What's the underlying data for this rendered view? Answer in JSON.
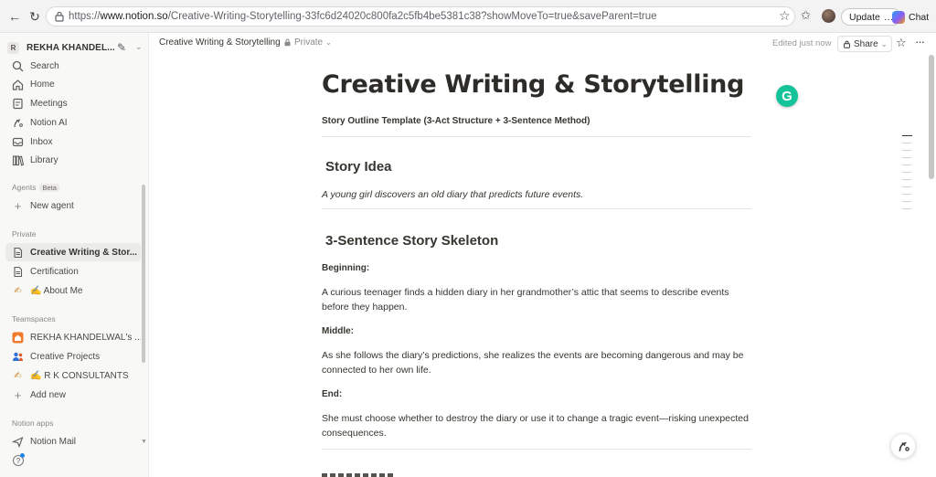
{
  "browser": {
    "url_scheme": "https://",
    "url_host": "www.notion.so",
    "url_path": "/Creative-Writing-Storytelling-33fc6d24020c800fa2c5fb4be5381c38?showMoveTo=true&saveParent=true",
    "update_label": "Update",
    "update_more": "…",
    "chat_label": "Chat"
  },
  "sidebar": {
    "workspace_badge": "R",
    "workspace_name": "REKHA KHANDEL...",
    "top_items": [
      {
        "label": "Search",
        "icon": "search-icon"
      },
      {
        "label": "Home",
        "icon": "home-icon"
      },
      {
        "label": "Meetings",
        "icon": "meetings-icon"
      },
      {
        "label": "Notion AI",
        "icon": "notion-ai-icon"
      },
      {
        "label": "Inbox",
        "icon": "inbox-icon"
      },
      {
        "label": "Library",
        "icon": "library-icon"
      }
    ],
    "agents_label": "Agents",
    "beta_label": "Beta",
    "new_agent": "New agent",
    "private_label": "Private",
    "private_items": [
      {
        "label": "Creative Writing & Stor...",
        "icon": "page-icon",
        "active": true
      },
      {
        "label": "Certification",
        "icon": "page-icon"
      },
      {
        "label": "✍️ About Me",
        "icon": "writing-hand-icon"
      }
    ],
    "teamspaces_label": "Teamspaces",
    "teamspace_items": [
      {
        "label": "REKHA KHANDELWAL's ...",
        "icon": "home-orange-icon"
      },
      {
        "label": "Creative Projects",
        "icon": "people-icon"
      },
      {
        "label": "✍️ R K CONSULTANTS",
        "icon": "writing-hand-icon"
      },
      {
        "label": "Add new",
        "icon": "plus-icon"
      }
    ],
    "notion_apps_label": "Notion apps",
    "notion_mail": "Notion Mail"
  },
  "topbar": {
    "breadcrumb": "Creative Writing & Storytelling",
    "privacy": "Private",
    "edited": "Edited just now",
    "share": "Share"
  },
  "page": {
    "title": "Creative Writing & Storytelling",
    "subtitle": "Story Outline Template (3-Act Structure + 3-Sentence Method)",
    "story_idea_heading": "Story Idea",
    "story_idea_text": "A young girl discovers an old diary that predicts future events.",
    "skeleton_heading": "3-Sentence Story Skeleton",
    "beginning_label": "Beginning:",
    "beginning_text": "A curious teenager finds a hidden diary in her grandmother’s attic that seems to describe events before they happen.",
    "middle_label": "Middle:",
    "middle_text": "As she follows the diary’s predictions, she realizes the events are becoming dangerous and may be connected to her own life.",
    "end_label": "End:",
    "end_text": "She must choose whether to destroy the diary or use it to change a tragic event—risking unexpected consequences."
  },
  "grammarly_letter": "G",
  "colors": {
    "accent_blue": "#2383e2",
    "grammarly_green": "#15c39a",
    "sidebar_bg": "#f8f8f7"
  }
}
